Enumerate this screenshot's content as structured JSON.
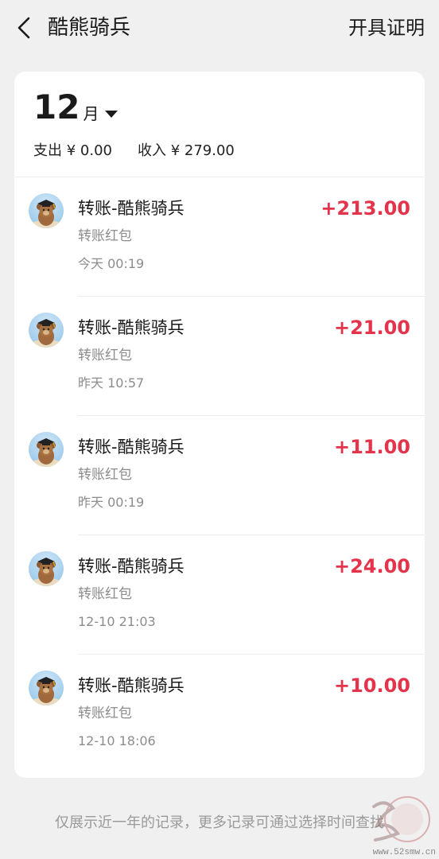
{
  "header": {
    "title": "酷熊骑兵",
    "action_label": "开具证明"
  },
  "month": {
    "number": "12",
    "unit": "月"
  },
  "summary": {
    "expense": "支出 ¥ 0.00",
    "income": "收入 ¥ 279.00"
  },
  "transactions": [
    {
      "name": "转账-酷熊骑兵",
      "type": "转账红包",
      "time": "今天 00:19",
      "amount": "+213.00"
    },
    {
      "name": "转账-酷熊骑兵",
      "type": "转账红包",
      "time": "昨天 10:57",
      "amount": "+21.00"
    },
    {
      "name": "转账-酷熊骑兵",
      "type": "转账红包",
      "time": "昨天 00:19",
      "amount": "+11.00"
    },
    {
      "name": "转账-酷熊骑兵",
      "type": "转账红包",
      "time": "12-10 21:03",
      "amount": "+24.00"
    },
    {
      "name": "转账-酷熊骑兵",
      "type": "转账红包",
      "time": "12-10 18:06",
      "amount": "+10.00"
    }
  ],
  "footer": {
    "note": "仅展示近一年的记录，更多记录可通过选择时间查找"
  },
  "watermark": {
    "text": "www.52smw.cn"
  },
  "colors": {
    "amount": "#e3344b",
    "background": "#f0f0f0",
    "card": "#ffffff"
  },
  "icons": {
    "back": "chevron-left-icon",
    "month_dropdown": "caret-down-icon",
    "avatar": "bear-graduate-avatar"
  }
}
